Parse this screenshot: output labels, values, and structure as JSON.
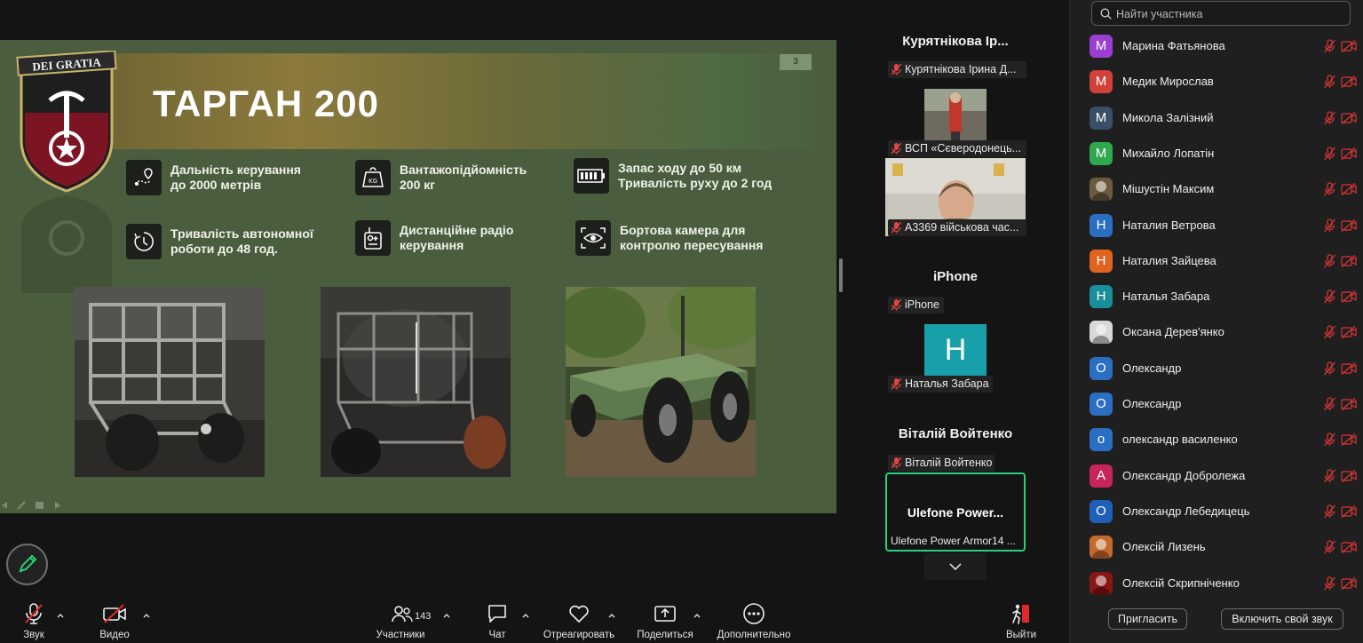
{
  "slide": {
    "title": "ТАРГАН 200",
    "page_number": "3",
    "logo_text": "DEI GRATIA",
    "features": [
      {
        "icon": "range-icon",
        "text": "Дальність керування до 2000 метрів"
      },
      {
        "icon": "weight-icon",
        "text": "Вантажопідйомність 200 кг"
      },
      {
        "icon": "battery-icon",
        "text": "Запас ходу до 50 км Тривалість руху до 2 год"
      },
      {
        "icon": "timer-icon",
        "text": "Тривалість автономної роботи до 48 год."
      },
      {
        "icon": "remote-control-icon",
        "text": "Дистанційне радіо керування"
      },
      {
        "icon": "eye-camera-icon",
        "text": "Бортова камера для контролю пересування"
      }
    ],
    "feature_lines": [
      [
        "Дальність керування",
        "до 2000 метрів"
      ],
      [
        "Вантажопідйомність",
        "200 кг"
      ],
      [
        "Запас ходу до 50 км",
        "Тривалість руху до 2 год"
      ],
      [
        "Тривалість автономної",
        "роботи до 48 год."
      ],
      [
        "Дистанційне радіо",
        "керування"
      ],
      [
        "Бортова камера для",
        "контролю пересування"
      ]
    ]
  },
  "gallery": {
    "tiles": [
      {
        "title": "Курятнікова Ір...",
        "tag": "Курятнікова Ірина Д..."
      },
      {
        "title": "",
        "tag": "ВСП «Сєверодонець..."
      },
      {
        "title": "",
        "tag": "А3369 військова час..."
      },
      {
        "title": "iPhone",
        "tag": "iPhone"
      },
      {
        "title": "",
        "tag": "Наталья Забара",
        "avatar_letter": "H"
      },
      {
        "title": "Віталій Войтенко",
        "tag": "Віталій Войтенко"
      },
      {
        "title": "Ulefone  Power...",
        "tag": "Ulefone Power Armor14 ..."
      }
    ]
  },
  "participants": {
    "search_placeholder": "Найти участника",
    "list": [
      {
        "name": "Марина Фатьянова",
        "initial": "M",
        "color": "#9b3fd1"
      },
      {
        "name": "Медик Мирослав",
        "initial": "M",
        "color": "#d0413a"
      },
      {
        "name": "Микола Залізний",
        "initial": "M",
        "color": "#3a4f66"
      },
      {
        "name": "Михайло Лопатін",
        "initial": "M",
        "color": "#2fa84f"
      },
      {
        "name": "Мішустін Максим",
        "initial": "",
        "color": "#6b5a3c"
      },
      {
        "name": "Наталия Ветрова",
        "initial": "H",
        "color": "#2b6fc2"
      },
      {
        "name": "Наталия Зайцева",
        "initial": "H",
        "color": "#e0641f"
      },
      {
        "name": "Наталья Забара",
        "initial": "H",
        "color": "#1a8e9a"
      },
      {
        "name": "Оксана Дерев'янко",
        "initial": "",
        "color": "#d8d8d8"
      },
      {
        "name": "Олександр",
        "initial": "O",
        "color": "#2b6fc2"
      },
      {
        "name": "Олександр",
        "initial": "O",
        "color": "#2b6fc2"
      },
      {
        "name": "олександр василенко",
        "initial": "o",
        "color": "#2b6fc2"
      },
      {
        "name": "Олександр Добролежа",
        "initial": "A",
        "color": "#c6245a"
      },
      {
        "name": "Олександр Лебедицець",
        "initial": "O",
        "color": "#1e5fb8"
      },
      {
        "name": "Олексій Лизень",
        "initial": "",
        "color": "#c36a2e"
      },
      {
        "name": "Олексій Скрипніченко",
        "initial": "",
        "color": "#8a1515"
      }
    ],
    "invite_label": "Пригласить",
    "unmute_self_label": "Включить свой звук"
  },
  "toolbar": {
    "audio_label": "Звук",
    "video_label": "Видео",
    "participants_label": "Участники",
    "participants_count": "143",
    "chat_label": "Чат",
    "react_label": "Отреагировать",
    "share_label": "Поделиться",
    "more_label": "Дополнительно",
    "leave_label": "Выйти"
  },
  "colors": {
    "slide_bg": "#4a5e3f",
    "leave_red": "#e02828",
    "mute_red": "#d93636",
    "active_speaker_border": "#2ad07a"
  }
}
